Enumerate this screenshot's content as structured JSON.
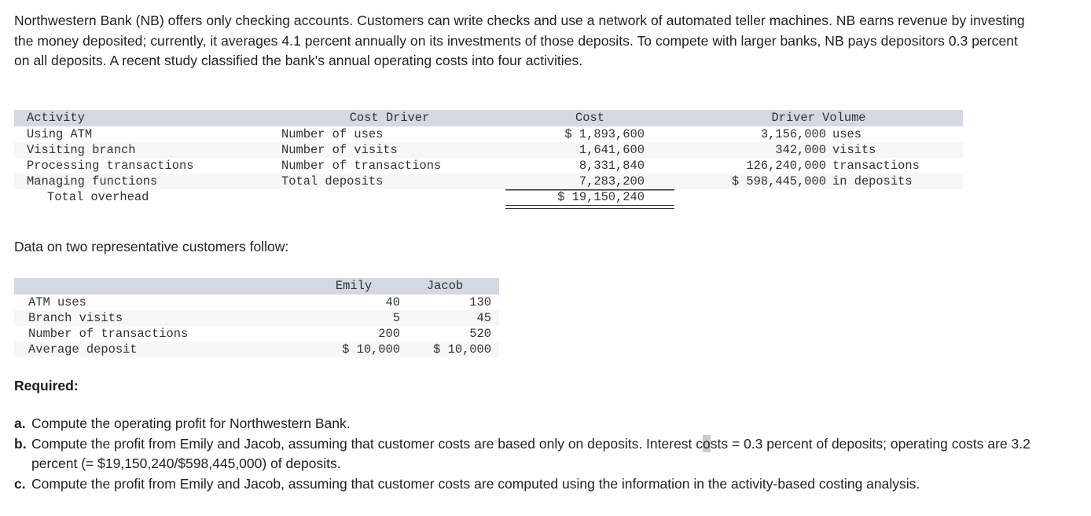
{
  "intro": {
    "paragraph": "Northwestern Bank (NB) offers only checking accounts. Customers can write checks and use a network of automated teller machines. NB earns revenue by investing the money deposited; currently, it averages 4.1 percent annually on its investments of those deposits. To compete with larger banks, NB pays depositors 0.3 percent on all deposits. A recent study classified the bank's annual operating costs into four activities."
  },
  "activity_table": {
    "headers": {
      "activity": "Activity",
      "cost_driver": "Cost Driver",
      "cost": "Cost",
      "driver_volume": "Driver Volume"
    },
    "rows": [
      {
        "activity": "Using ATM",
        "cost_driver": "Number of uses",
        "cost": "$ 1,893,600",
        "volume": "3,156,000",
        "unit": "uses"
      },
      {
        "activity": "Visiting branch",
        "cost_driver": "Number of visits",
        "cost": "1,641,600",
        "volume": "342,000",
        "unit": "visits"
      },
      {
        "activity": "Processing transactions",
        "cost_driver": "Number of transactions",
        "cost": "8,331,840",
        "volume": "126,240,000",
        "unit": "transactions"
      },
      {
        "activity": "Managing functions",
        "cost_driver": "Total deposits",
        "cost": "7,283,200",
        "volume": "$ 598,445,000",
        "unit": "in deposits"
      }
    ],
    "total": {
      "label": "Total overhead",
      "cost": "$ 19,150,240"
    }
  },
  "mid_text": "Data on two representative customers follow:",
  "customer_table": {
    "headers": {
      "blank": "",
      "emily": "Emily",
      "jacob": "Jacob"
    },
    "rows": [
      {
        "label": "ATM uses",
        "emily": "40",
        "jacob": "130"
      },
      {
        "label": "Branch visits",
        "emily": "5",
        "jacob": "45"
      },
      {
        "label": "Number of transactions",
        "emily": "200",
        "jacob": "520"
      },
      {
        "label": "Average deposit",
        "emily": "$ 10,000",
        "jacob": "$ 10,000"
      }
    ]
  },
  "required": {
    "heading": "Required:",
    "items": [
      {
        "marker": "a.",
        "text": "Compute the operating profit for Northwestern Bank."
      },
      {
        "marker": "b.",
        "text_before_caret": "Compute the profit from Emily and Jacob, assuming that customer costs are based only on deposits. Interest c",
        "caret_char": "o",
        "text_after_caret": "sts = 0.3 percent of deposits; operating costs are 3.2 percent (= $19,150,240/$598,445,000) of deposits."
      },
      {
        "marker": "c.",
        "text": "Compute the profit from Emily and Jacob, assuming that customer costs are computed using the information in the activity-based costing analysis."
      }
    ]
  },
  "colors": {
    "header_band": "#d4d8e2",
    "stripe": "#f7f7f7",
    "table_text": "#2e3338",
    "body_text": "#222222",
    "rule": "#2e3338"
  }
}
